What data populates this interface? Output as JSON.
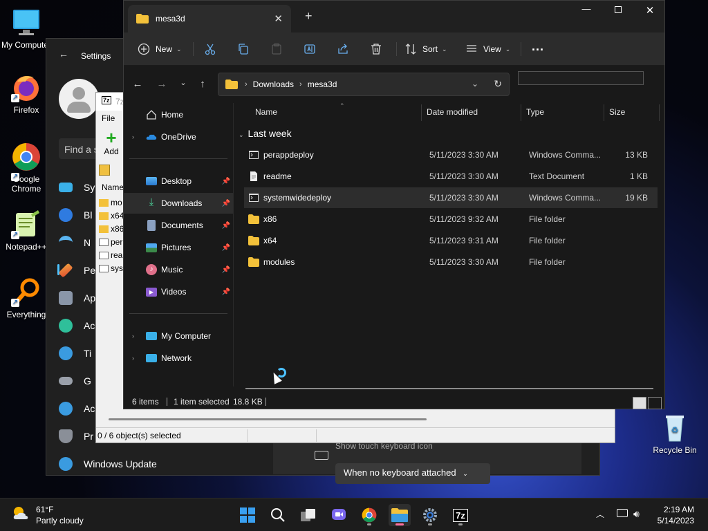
{
  "desktop": {
    "icons": [
      {
        "label": "My Computer"
      },
      {
        "label": "Firefox"
      },
      {
        "label": "Google Chrome"
      },
      {
        "label": "Notepad++"
      },
      {
        "label": "Everything"
      },
      {
        "label": "Recycle Bin"
      }
    ]
  },
  "settings": {
    "title": "Settings",
    "find_placeholder": "Find a s",
    "nav_items": [
      "Sy",
      "Bl",
      "N",
      "Pe",
      "Ap",
      "Ac",
      "Ti",
      "G",
      "Ac",
      "Pr",
      "Windows Update"
    ],
    "keyboard_text": "Show touch keyboard icon",
    "keyboard_value": "When no keyboard attached"
  },
  "sevenzip": {
    "title": "7z",
    "menu_file": "File",
    "add_label": "Add",
    "column_name": "Name",
    "rows": [
      "mo",
      "x64",
      "x86",
      "per",
      "rea",
      "sys"
    ],
    "status": "0 / 6 object(s) selected"
  },
  "explorer": {
    "tab_title": "mesa3d",
    "toolbar": {
      "new_label": "New",
      "sort_label": "Sort",
      "view_label": "View",
      "more_label": "..."
    },
    "address": {
      "crumbs": [
        "Downloads",
        "mesa3d"
      ]
    },
    "nav": {
      "home": "Home",
      "onedrive": "OneDrive",
      "desktop": "Desktop",
      "downloads": "Downloads",
      "documents": "Documents",
      "pictures": "Pictures",
      "music": "Music",
      "videos": "Videos",
      "my_computer": "My Computer",
      "network": "Network"
    },
    "columns": {
      "name": "Name",
      "date": "Date modified",
      "type": "Type",
      "size": "Size"
    },
    "group_label": "Last week",
    "files": [
      {
        "name": "perappdeploy",
        "date": "5/11/2023 3:30 AM",
        "type": "Windows Comma...",
        "size": "13 KB",
        "icon": "cmd"
      },
      {
        "name": "readme",
        "date": "5/11/2023 3:30 AM",
        "type": "Text Document",
        "size": "1 KB",
        "icon": "txt"
      },
      {
        "name": "systemwidedeploy",
        "date": "5/11/2023 3:30 AM",
        "type": "Windows Comma...",
        "size": "19 KB",
        "icon": "cmd"
      },
      {
        "name": "x86",
        "date": "5/11/2023 9:32 AM",
        "type": "File folder",
        "size": "",
        "icon": "folder"
      },
      {
        "name": "x64",
        "date": "5/11/2023 9:31 AM",
        "type": "File folder",
        "size": "",
        "icon": "folder"
      },
      {
        "name": "modules",
        "date": "5/11/2023 3:30 AM",
        "type": "File folder",
        "size": "",
        "icon": "folder"
      }
    ],
    "selected_index": 2,
    "status": {
      "items": "6 items",
      "selected": "1 item selected",
      "size": "18.8 KB"
    }
  },
  "taskbar": {
    "weather_temp": "61°F",
    "weather_desc": "Partly cloudy",
    "time": "2:19 AM",
    "date": "5/14/2023"
  },
  "colors": {
    "accent": "#4cc2ff",
    "folder_yellow": "#f3c13a",
    "explorer_bg": "#191919"
  }
}
